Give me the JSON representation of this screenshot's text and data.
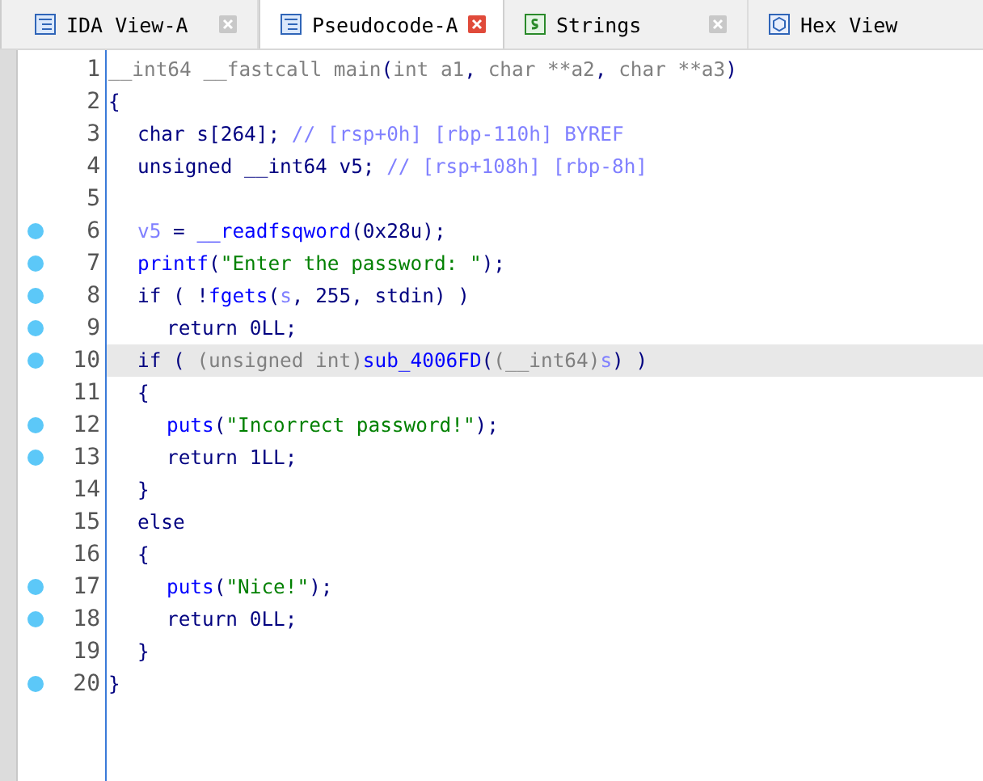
{
  "tabs": [
    {
      "label": "IDA View-A",
      "kind": "view",
      "selected": false
    },
    {
      "label": "Pseudocode-A",
      "kind": "view",
      "selected": true
    },
    {
      "label": "Strings",
      "kind": "strings",
      "selected": false
    },
    {
      "label": "Hex View",
      "kind": "hex",
      "selected": false
    }
  ],
  "lines": [
    {
      "number": "1",
      "breakpoint": false,
      "highlighted": false,
      "segments": [
        {
          "kind": "type",
          "text": "__int64 __fastcall main"
        },
        {
          "kind": "plain",
          "text": "("
        },
        {
          "kind": "type",
          "text": "int a1"
        },
        {
          "kind": "plain",
          "text": ", "
        },
        {
          "kind": "type",
          "text": "char **a2"
        },
        {
          "kind": "plain",
          "text": ", "
        },
        {
          "kind": "type",
          "text": "char **a3"
        },
        {
          "kind": "plain",
          "text": ")"
        }
      ]
    },
    {
      "number": "2",
      "breakpoint": false,
      "highlighted": false,
      "segments": [
        {
          "kind": "plain",
          "text": "{"
        }
      ],
      "children": [
        {
          "number": "3",
          "breakpoint": false,
          "highlighted": false,
          "segments": [
            {
              "kind": "plain",
              "text": "char s[264]; "
            },
            {
              "kind": "comment",
              "text": "// [rsp+0h] [rbp-110h] BYREF"
            }
          ]
        },
        {
          "number": "4",
          "breakpoint": false,
          "highlighted": false,
          "segments": [
            {
              "kind": "plain",
              "text": "unsigned __int64 v5; "
            },
            {
              "kind": "comment",
              "text": "// [rsp+108h] [rbp-8h]"
            }
          ]
        },
        {
          "number": "5",
          "breakpoint": false,
          "highlighted": false
        },
        {
          "number": "6",
          "breakpoint": true,
          "highlighted": false,
          "segments": [
            {
              "kind": "var",
              "text": "v5"
            },
            {
              "kind": "plain",
              "text": " = "
            },
            {
              "kind": "func",
              "text": "__readfsqword"
            },
            {
              "kind": "plain",
              "text": "(0x28u);"
            }
          ]
        },
        {
          "number": "7",
          "breakpoint": true,
          "highlighted": false,
          "segments": [
            {
              "kind": "func",
              "text": "printf"
            },
            {
              "kind": "plain",
              "text": "("
            },
            {
              "kind": "string",
              "text": "\"Enter the password: \""
            },
            {
              "kind": "plain",
              "text": ");"
            }
          ]
        },
        {
          "number": "8",
          "breakpoint": true,
          "highlighted": false,
          "segments": [
            {
              "kind": "plain",
              "text": "if ( !"
            },
            {
              "kind": "func",
              "text": "fgets"
            },
            {
              "kind": "plain",
              "text": "("
            },
            {
              "kind": "var",
              "text": "s"
            },
            {
              "kind": "plain",
              "text": ", 255, stdin) )"
            }
          ],
          "children": [
            {
              "number": "9",
              "breakpoint": true,
              "highlighted": false,
              "segments": [
                {
                  "kind": "plain",
                  "text": "return 0LL;"
                }
              ]
            }
          ]
        },
        {
          "number": "10",
          "breakpoint": true,
          "highlighted": true,
          "segments": [
            {
              "kind": "plain",
              "text": "if ( "
            },
            {
              "kind": "type",
              "text": "(unsigned int)"
            },
            {
              "kind": "func",
              "text": "sub_4006FD"
            },
            {
              "kind": "plain",
              "text": "("
            },
            {
              "kind": "type",
              "text": "(__int64)"
            },
            {
              "kind": "var",
              "text": "s"
            },
            {
              "kind": "plain",
              "text": ") )"
            }
          ]
        },
        {
          "number": "11",
          "breakpoint": false,
          "highlighted": false,
          "segments": [
            {
              "kind": "plain",
              "text": "{"
            }
          ],
          "children": [
            {
              "number": "12",
              "breakpoint": true,
              "highlighted": false,
              "segments": [
                {
                  "kind": "func",
                  "text": "puts"
                },
                {
                  "kind": "plain",
                  "text": "("
                },
                {
                  "kind": "string",
                  "text": "\"Incorrect password!\""
                },
                {
                  "kind": "plain",
                  "text": ");"
                }
              ]
            },
            {
              "number": "13",
              "breakpoint": true,
              "highlighted": false,
              "segments": [
                {
                  "kind": "plain",
                  "text": "return 1LL;"
                }
              ]
            }
          ]
        },
        {
          "number": "14",
          "breakpoint": false,
          "highlighted": false,
          "segments": [
            {
              "kind": "plain",
              "text": "}"
            }
          ]
        },
        {
          "number": "15",
          "breakpoint": false,
          "highlighted": false,
          "segments": [
            {
              "kind": "plain",
              "text": "else"
            }
          ]
        },
        {
          "number": "16",
          "breakpoint": false,
          "highlighted": false,
          "segments": [
            {
              "kind": "plain",
              "text": "{"
            }
          ],
          "children": [
            {
              "number": "17",
              "breakpoint": true,
              "highlighted": false,
              "segments": [
                {
                  "kind": "func",
                  "text": "puts"
                },
                {
                  "kind": "plain",
                  "text": "("
                },
                {
                  "kind": "string",
                  "text": "\"Nice!\""
                },
                {
                  "kind": "plain",
                  "text": ");"
                }
              ]
            },
            {
              "number": "18",
              "breakpoint": true,
              "highlighted": false,
              "segments": [
                {
                  "kind": "plain",
                  "text": "return 0LL;"
                }
              ]
            }
          ]
        },
        {
          "number": "19",
          "breakpoint": false,
          "highlighted": false,
          "segments": [
            {
              "kind": "plain",
              "text": "}"
            }
          ]
        }
      ]
    },
    {
      "number": "20",
      "breakpoint": true,
      "highlighted": false,
      "segments": [
        {
          "kind": "plain",
          "text": "}"
        }
      ]
    }
  ]
}
